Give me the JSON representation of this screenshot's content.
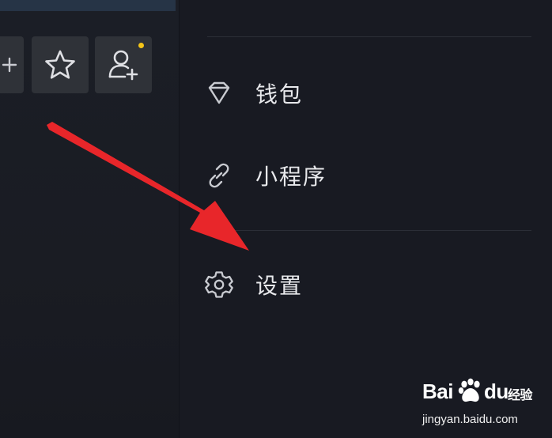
{
  "menu": {
    "items": [
      {
        "label": "钱包",
        "icon": "diamond-icon"
      },
      {
        "label": "小程序",
        "icon": "link-icon"
      },
      {
        "label": "设置",
        "icon": "gear-icon"
      }
    ]
  },
  "toolbar": {
    "buttons": [
      {
        "icon": "add-icon"
      },
      {
        "icon": "star-icon"
      },
      {
        "icon": "add-friend-icon",
        "has_notification": true
      }
    ]
  },
  "watermark": {
    "brand_a": "Bai",
    "brand_b": "du",
    "suffix": "经验",
    "url": "jingyan.baidu.com"
  },
  "colors": {
    "background": "#181a22",
    "label": "#e8e9ec",
    "icon": "#c9cbd1",
    "notification_dot": "#f5c518",
    "arrow": "#e8262a"
  }
}
